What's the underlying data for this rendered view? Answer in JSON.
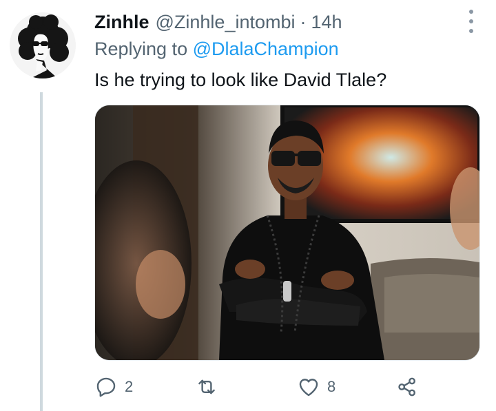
{
  "tweet": {
    "author_name": "Zinhle",
    "author_handle": "@Zinhle_intombi",
    "separator": "·",
    "time": "14h",
    "replying_prefix": "Replying to",
    "replying_handle": "@DlalaChampion",
    "text": "Is he trying to look like David Tlale?"
  },
  "actions": {
    "reply_count": "2",
    "like_count": "8"
  },
  "icons": {
    "reply": "reply-icon",
    "retweet": "retweet-icon",
    "like": "heart-icon",
    "share": "share-icon",
    "more": "more-options-icon"
  },
  "colors": {
    "link": "#1d9bf0",
    "secondary_text": "#536471",
    "primary_text": "#0f1419",
    "thread_line": "#cfd9de"
  }
}
